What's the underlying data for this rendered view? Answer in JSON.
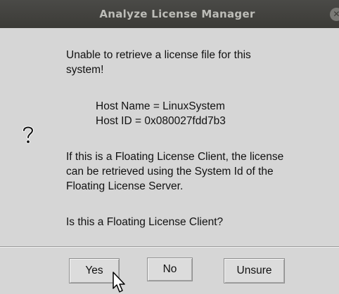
{
  "window": {
    "title": "Analyze License Manager"
  },
  "dialog": {
    "icon": "question-mark-icon",
    "message_line1": "Unable to retrieve a license file for this",
    "message_line2": "system!",
    "host_name": "Host Name = LinuxSystem",
    "host_id": "Host ID = 0x080027fdd7b3",
    "info_line1": "If this is a Floating License Client, the license",
    "info_line2": "can be retrieved using the System Id of the",
    "info_line3": "Floating License Server.",
    "question": "Is this a Floating License Client?"
  },
  "buttons": {
    "yes_label": "Yes",
    "no_label": "No",
    "unsure_label": "Unsure"
  },
  "colors": {
    "titlebar": "#3c3b37",
    "dialog_bg": "#d6d6d6",
    "title_text": "#bdbdb8"
  }
}
